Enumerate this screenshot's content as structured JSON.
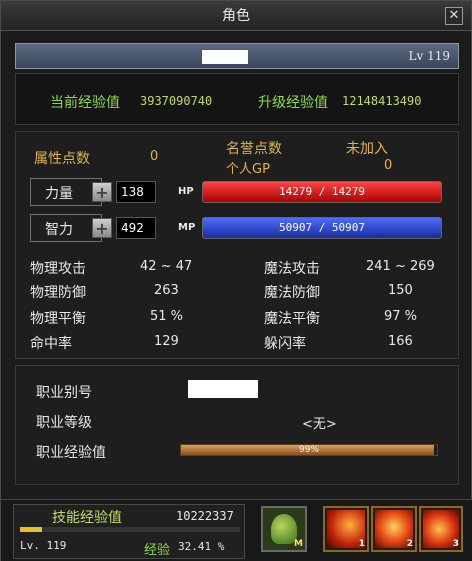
{
  "window": {
    "title": "角色",
    "close_label": "✕"
  },
  "header": {
    "level": "Lv 119"
  },
  "experience": {
    "current_label": "当前经验值",
    "current_value": "3937090740",
    "next_label": "升级经验值",
    "next_value": "12148413490"
  },
  "points": {
    "attr_label": "属性点数",
    "attr_value": "0",
    "honor_label": "名誉点数",
    "honor_value": "未加入",
    "gp_label": "个人GP",
    "gp_value": "0"
  },
  "primary_stats": [
    {
      "label": "力量",
      "value": "138",
      "bar_label": "HP",
      "bar_text": "14279 / 14279",
      "fill": 1.0
    },
    {
      "label": "智力",
      "value": "492",
      "bar_label": "MP",
      "bar_text": "50907 / 50907",
      "fill": 1.0
    }
  ],
  "combat_stats": {
    "left": [
      {
        "label": "物理攻击",
        "value": "42 ~ 47"
      },
      {
        "label": "物理防御",
        "value": "263"
      },
      {
        "label": "物理平衡",
        "value": "51 %"
      },
      {
        "label": "命中率",
        "value": "129"
      }
    ],
    "right": [
      {
        "label": "魔法攻击",
        "value": "241 ~ 269"
      },
      {
        "label": "魔法防御",
        "value": "150"
      },
      {
        "label": "魔法平衡",
        "value": "97 %"
      },
      {
        "label": "躲闪率",
        "value": "166"
      }
    ]
  },
  "job": {
    "alias_label": "职业别号",
    "level_label": "职业等级",
    "level_value": "<无>",
    "exp_label": "职业经验值",
    "exp_text": "99%",
    "exp_fill": 0.99
  },
  "skill_exp": {
    "label": "技能经验值",
    "value": "10222337",
    "level": "Lv.  119",
    "exp_label": "经验",
    "exp_value": "32.41 %",
    "fill": 0.1
  },
  "hotbar": [
    {
      "icon": "character-icon",
      "key": "M"
    },
    {
      "icon": "fire-skill-icon",
      "key": "1"
    },
    {
      "icon": "fire-skill-icon",
      "key": "2"
    },
    {
      "icon": "fire-skill-icon",
      "key": "3"
    }
  ],
  "colors": {
    "hp": "#d01010",
    "mp": "#2a3cc8",
    "gold": "#e0b44a",
    "green": "#8fdc3c"
  }
}
